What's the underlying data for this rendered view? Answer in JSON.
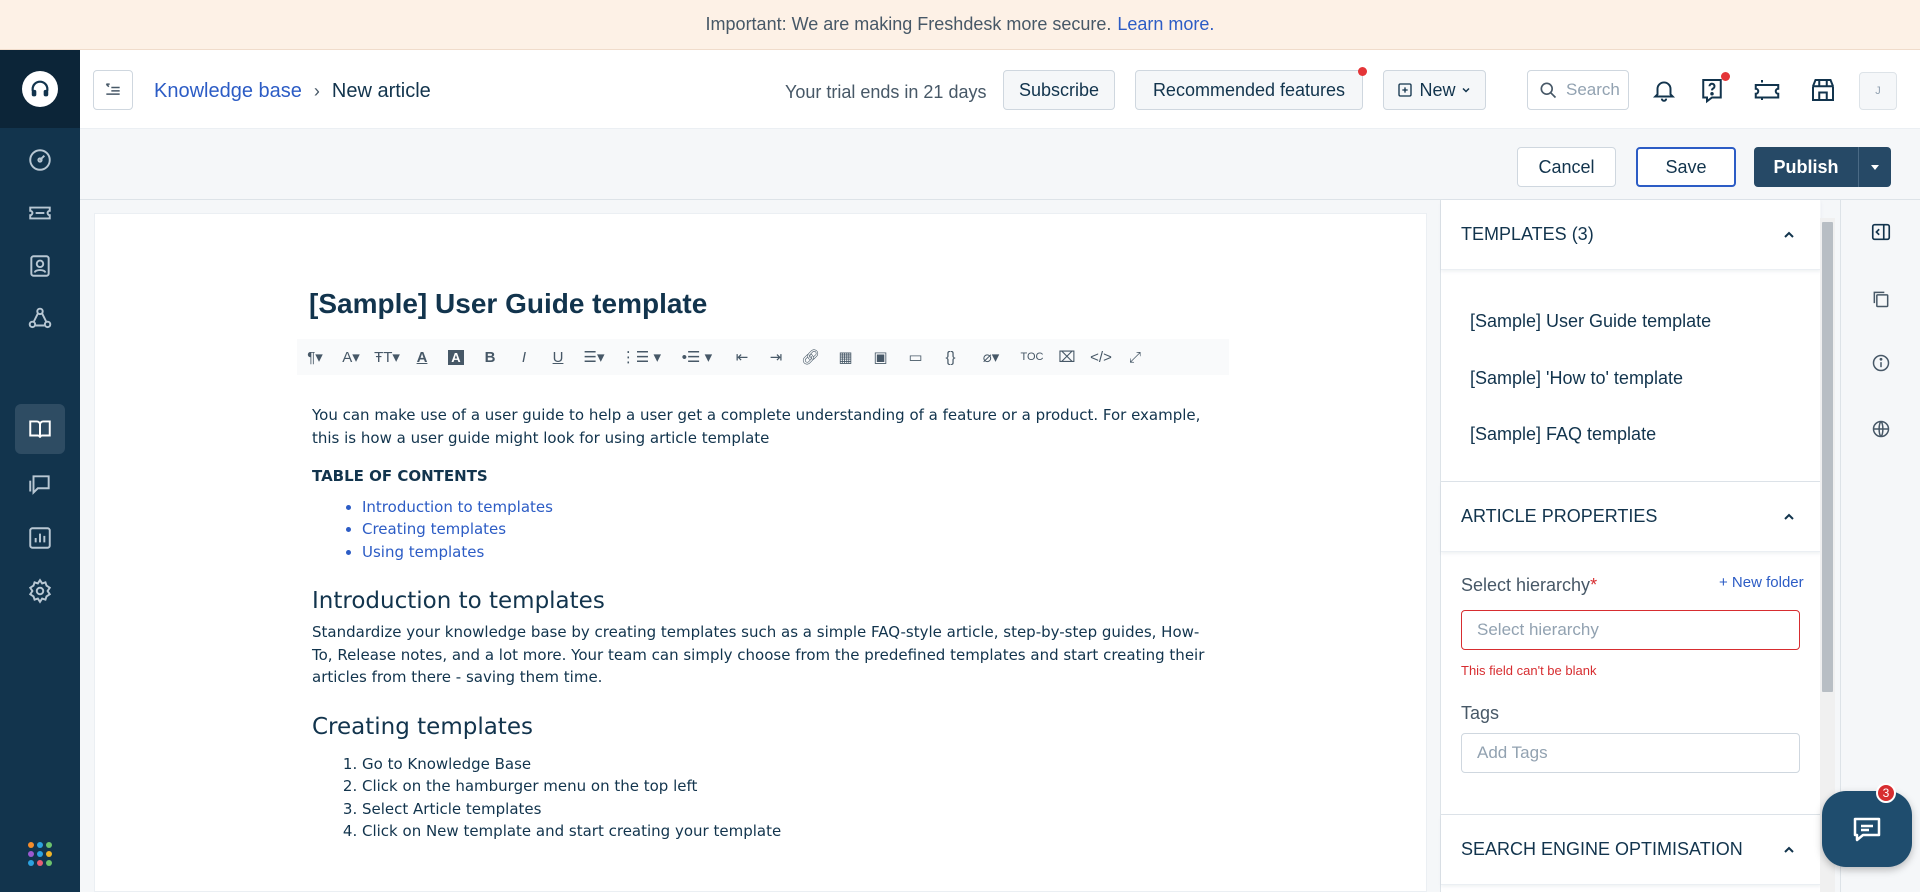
{
  "banner": {
    "text": "Important: We are making Freshdesk more secure.",
    "link": "Learn more."
  },
  "nav": {
    "items": [
      "dashboard-icon",
      "tickets-icon",
      "contacts-icon",
      "groups-icon",
      "knowledge-base-icon",
      "forums-icon",
      "reports-icon",
      "settings-icon"
    ],
    "active": "knowledge-base-icon"
  },
  "header": {
    "breadcrumb_root": "Knowledge base",
    "breadcrumb_sep": "›",
    "breadcrumb_current": "New article",
    "trial": "Your trial ends in 21 days",
    "subscribe": "Subscribe",
    "recommended": "Recommended features",
    "new_label": "New",
    "search_placeholder": "Search",
    "avatar": "J"
  },
  "actions": {
    "cancel": "Cancel",
    "save": "Save",
    "publish": "Publish"
  },
  "article": {
    "title": "[Sample] User Guide template",
    "toolbar": [
      "paragraph-format-icon",
      "font-family-icon",
      "font-size-icon",
      "text-color-icon",
      "background-color-icon",
      "bold-icon",
      "italic-icon",
      "underline-icon",
      "align-icon",
      "ordered-list-icon",
      "unordered-list-icon",
      "outdent-icon",
      "indent-icon",
      "link-icon",
      "table-icon",
      "image-icon",
      "video-icon",
      "code-block-icon",
      "attachment-icon",
      "toc-icon",
      "clear-format-icon",
      "code-view-icon",
      "fullscreen-icon"
    ],
    "toolbar_toc_text": "TOC",
    "intro": "You can make use of a user guide to help a user get a complete understanding of a feature or a product. For example, this is how a user guide might look for using article template",
    "toc_heading": "TABLE OF CONTENTS",
    "toc": [
      "Introduction to templates",
      "Creating templates",
      "Using templates"
    ],
    "h_intro": "Introduction to templates",
    "p_intro": "Standardize your knowledge base by creating templates such as a simple FAQ-style article, step-by-step guides, How-To, Release notes, and a lot more. Your team can simply choose from the predefined templates and start creating their articles from there - saving them time.",
    "h_create": "Creating templates",
    "steps": [
      "Go to Knowledge Base",
      "Click on the hamburger menu on the top left",
      "Select Article templates",
      "Click on New template and start creating your template"
    ]
  },
  "panel": {
    "templates_heading": "TEMPLATES (3)",
    "templates": [
      "[Sample] User Guide template",
      "[Sample] 'How to' template",
      "[Sample] FAQ template"
    ],
    "properties_heading": "ARTICLE PROPERTIES",
    "hierarchy_label": "Select hierarchy",
    "required_mark": "*",
    "new_folder": "+ New folder",
    "hierarchy_placeholder": "Select hierarchy",
    "hierarchy_error": "This field can't be blank",
    "tags_label": "Tags",
    "tags_placeholder": "Add Tags",
    "seo_heading": "SEARCH ENGINE OPTIMISATION"
  },
  "chat": {
    "badge": "3"
  },
  "colors": {
    "nav_bg": "#12344d",
    "primary": "#2c5cc5",
    "publish": "#264966",
    "error": "#d72d30"
  }
}
